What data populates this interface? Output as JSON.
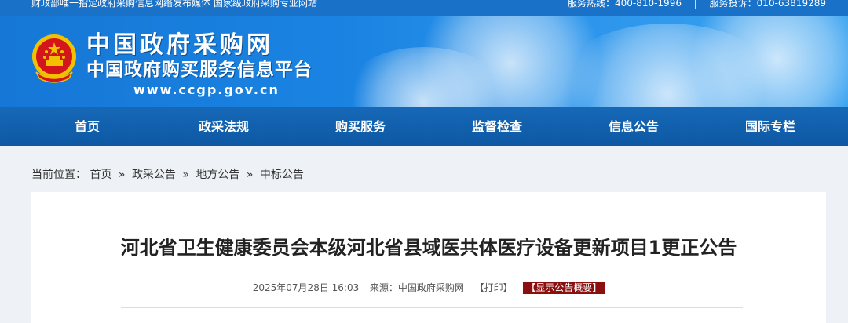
{
  "top_strip": {
    "slogan": "财政部唯一指定政府采购信息网络发布媒体 国家级政府采购专业网站",
    "hotline": "服务热线：400-810-1996",
    "complaint": "服务投诉：010-63819289",
    "separator": "|"
  },
  "banner": {
    "title": "中国政府采购网",
    "subtitle": "中国政府购买服务信息平台",
    "url": "www.ccgp.gov.cn",
    "emblem_icon": "national-emblem-icon"
  },
  "nav": {
    "items": [
      "首页",
      "政采法规",
      "购买服务",
      "监督检查",
      "信息公告",
      "国际专栏"
    ]
  },
  "breadcrumb": {
    "prefix": "当前位置：",
    "items": [
      "首页",
      "政采公告",
      "地方公告",
      "中标公告"
    ],
    "arrow": "»"
  },
  "article": {
    "title": "河北省卫生健康委员会本级河北省县域医共体医疗设备更新项目1更正公告",
    "datetime": "2025年07月28日 16:03",
    "source": "来源：中国政府采购网",
    "print": "【打印】",
    "summary_button": "【显示公告概要】"
  },
  "colors": {
    "brand_blue": "#1a71c8",
    "nav_blue": "#0e58a3",
    "summary_red": "#8b0f0f"
  }
}
